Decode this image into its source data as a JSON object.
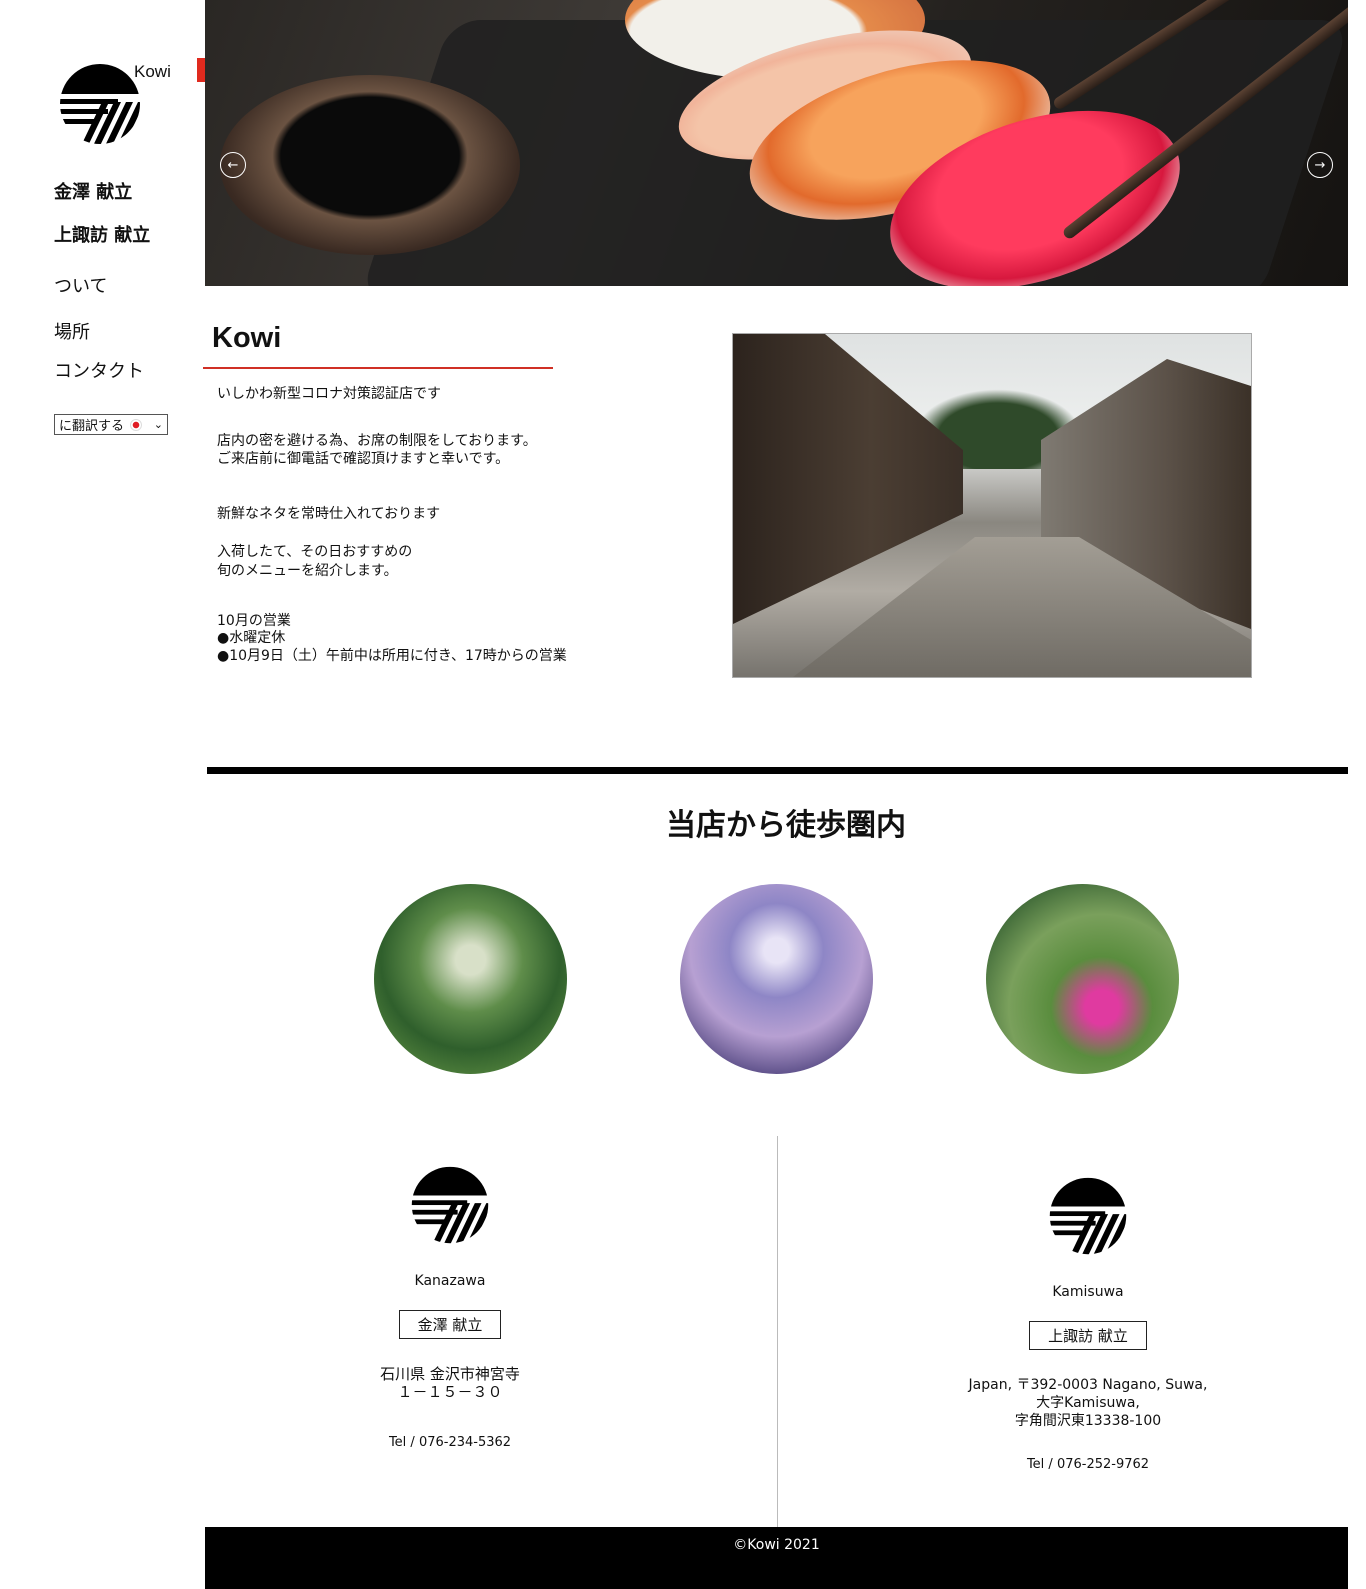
{
  "brand": {
    "name": "Kowi"
  },
  "nav": {
    "kanazawa_menu": "金澤 献立",
    "kamisuwa_menu": "上諏訪 献立",
    "about": "ついて",
    "location": "場所",
    "contact": "コンタクト"
  },
  "translate": {
    "label": "に翻訳する"
  },
  "hero": {
    "prev_icon": "←",
    "next_icon": "→"
  },
  "intro": {
    "title": "Kowi",
    "line1": "いしかわ新型コロナ対策認証店です",
    "line2": "店内の密を避ける為、お席の制限をしております。",
    "line3": "ご来店前に御電話で確認頂けますと幸いです。",
    "line4": "新鮮なネタを常時仕入れております",
    "line5": "入荷したて、その日おすすめの",
    "line6": "旬のメニューを紹介します。",
    "line7": "10月の営業",
    "line8": "●水曜定休",
    "line9": "●10月9日（土）午前中は所用に付き、17時からの営業"
  },
  "walking": {
    "title": "当店から徒歩圏内"
  },
  "locations": [
    {
      "name": "Kanazawa",
      "button": "金澤 献立",
      "address": "石川県 金沢市神宮寺\n１－１５－３０",
      "tel": "Tel / 076-234-5362"
    },
    {
      "name": "Kamisuwa",
      "button": "上諏訪 献立",
      "address": "Japan, 〒392-0003 Nagano, Suwa,\n大字Kamisuwa,\n字角間沢東13338-100",
      "tel": "Tel / 076-252-9762"
    }
  ],
  "footer": {
    "copyright": "©Kowi 2021"
  },
  "colors": {
    "accent_red": "#e02a1e",
    "black": "#000000"
  }
}
